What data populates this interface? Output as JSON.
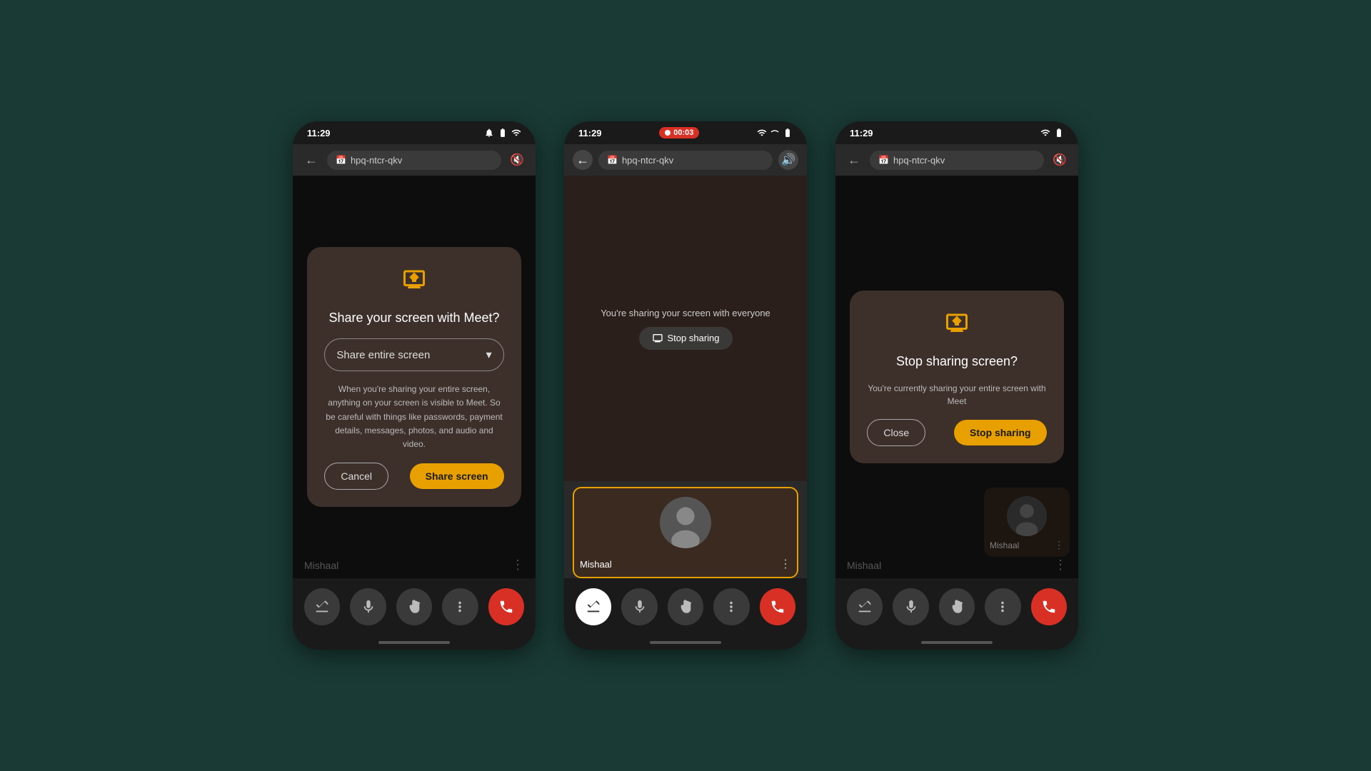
{
  "phones": [
    {
      "id": "phone1",
      "statusBar": {
        "time": "11:29",
        "showRecording": false
      },
      "browserBar": {
        "backActive": false,
        "url": "hpq-ntcr-qkv",
        "soundActive": false
      },
      "modal": {
        "type": "share-screen",
        "title": "Share your screen with Meet?",
        "dropdown": "Share entire screen",
        "warningText": "When you're sharing your entire screen, anything on your screen is visible to Meet. So be careful with things like passwords, payment details, messages, photos, and audio and video.",
        "cancelLabel": "Cancel",
        "shareLabel": "Share screen"
      },
      "participant": {
        "name": "Mishaal"
      },
      "controls": [
        "camera-off",
        "mic",
        "hand",
        "more",
        "end-call"
      ]
    },
    {
      "id": "phone2",
      "statusBar": {
        "time": "11:29",
        "showRecording": true,
        "recordingTime": "00:03"
      },
      "browserBar": {
        "backActive": true,
        "url": "hpq-ntcr-qkv",
        "soundActive": true
      },
      "sharingText": "You're sharing your screen with everyone",
      "stopSharingLabel": "Stop sharing",
      "participant": {
        "name": "Mishaal",
        "highlighted": true
      },
      "controls": [
        "camera-off-white",
        "mic",
        "hand",
        "more",
        "end-call"
      ]
    },
    {
      "id": "phone3",
      "statusBar": {
        "time": "11:29",
        "showRecording": false
      },
      "browserBar": {
        "backActive": false,
        "url": "hpq-ntcr-qkv",
        "soundActive": false
      },
      "modal": {
        "type": "stop-sharing",
        "title": "Stop sharing screen?",
        "subtitleText": "You're currently sharing your entire screen with Meet",
        "closeLabel": "Close",
        "stopLabel": "Stop sharing"
      },
      "participant": {
        "name": "Mishaal"
      },
      "controls": [
        "camera-off",
        "mic",
        "hand",
        "more",
        "end-call"
      ]
    }
  ]
}
